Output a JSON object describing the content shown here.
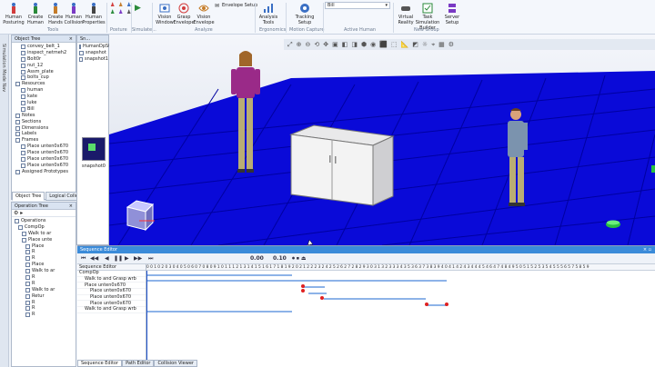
{
  "ribbon": {
    "buttons": [
      {
        "label": "Human Posturing",
        "icon": "human-posture-icon"
      },
      {
        "label": "Create Human",
        "icon": "create-human-icon"
      },
      {
        "label": "Create Hands",
        "icon": "create-hands-icon"
      },
      {
        "label": "Human Collision",
        "icon": "human-collision-icon"
      },
      {
        "label": "Human Properties",
        "icon": "human-properties-icon"
      },
      {
        "label": "Vision Window",
        "icon": "vision-window-icon"
      },
      {
        "label": "Grasp Envelope",
        "icon": "grasp-envelope-icon"
      },
      {
        "label": "Vision Envelope",
        "icon": "vision-envelope-icon"
      },
      {
        "label": "Analysis Tools",
        "icon": "analysis-tools-icon"
      },
      {
        "label": "Tracking Setup",
        "icon": "tracking-setup-icon"
      },
      {
        "label": "Virtual Reality",
        "icon": "virtual-reality-icon"
      },
      {
        "label": "Task Simulation Builder",
        "icon": "task-simulation-builder-icon"
      },
      {
        "label": "Server Setup",
        "icon": "server-setup-icon"
      }
    ],
    "small": {
      "envelope_setup": "Envelope Setup"
    },
    "groups": {
      "tools": "Tools",
      "posture": "Posture",
      "simulate": "Simulate...",
      "analyze": "Analyze",
      "ergonomics": "Ergonomics",
      "motion_capture": "Motion Capture",
      "active_human": "Active Human",
      "new_group": "New Group"
    },
    "active_human_value": "Bill"
  },
  "side": {
    "label": "Simulation Mode Nav"
  },
  "object_tree": {
    "title": "Object Tree",
    "items": [
      "convey_belt_1",
      "inspect_netmeh2",
      "Bolt0r",
      "nut_12",
      "Assm_plate",
      "bolts_cup",
      "Resources",
      "human",
      "kate",
      "luke",
      "Bill",
      "Notes",
      "Sections",
      "Dimensions",
      "Labels",
      "Frames",
      "Place unten0x670",
      "Place unten0x670",
      "Place unten0x670",
      "Place unten0x670",
      "Assigned Prototypes"
    ],
    "tabs": [
      "Object Tree",
      "Logical Collect"
    ]
  },
  "sn_panel": {
    "title": "Sn...",
    "items": [
      "HumanDpStan",
      "snapshot",
      "snapshot1"
    ],
    "thumb_label": "snapshot0"
  },
  "operation_tree": {
    "title": "Operation Tree",
    "items": [
      "Operations",
      "CompOp",
      "Walk to ar",
      "Place unte",
      "Place",
      "R",
      "R",
      "Place",
      "Walk to ar",
      "R",
      "R",
      "Walk to ar",
      "Retur",
      "R",
      "R",
      "R"
    ]
  },
  "sequence_editor": {
    "title": "Sequence Editor",
    "header": "Sequence Editor",
    "time_start": "0.00",
    "time_step": "0.10",
    "rows": [
      "CompOp",
      "Walk to and Grasp wrb",
      "Place unten0x670",
      "Place unten0x670",
      "Place unten0x670",
      "Place unten0x670",
      "Walk to and Grasp wrb"
    ],
    "ruler": "0 0 1 0 2 0 3 0 4 0 5 0 6 0 7 0 8 0 9 1 0 1 1 1 2 1 3 1 4 1 5 1 6 1 7 1 8 1 9 2 0 2 1 2 2 2 3 2 4 2 5 2 6 2 7 2 8 2 9 3 0 3 1 3 2 3 3 3 4 3 5 3 6 3 7 3 8 3 9 4 0 4 1 4 2 4 3 4 4 4 5 4 6 4 7 4 8 4 9 5 0 5 1 5 2 5 3 5 4 5 5 5 6 5 7 5 8 5 9"
  },
  "bottom_tabs": [
    "Sequence Editor",
    "Path Editor",
    "Collision Viewer"
  ]
}
